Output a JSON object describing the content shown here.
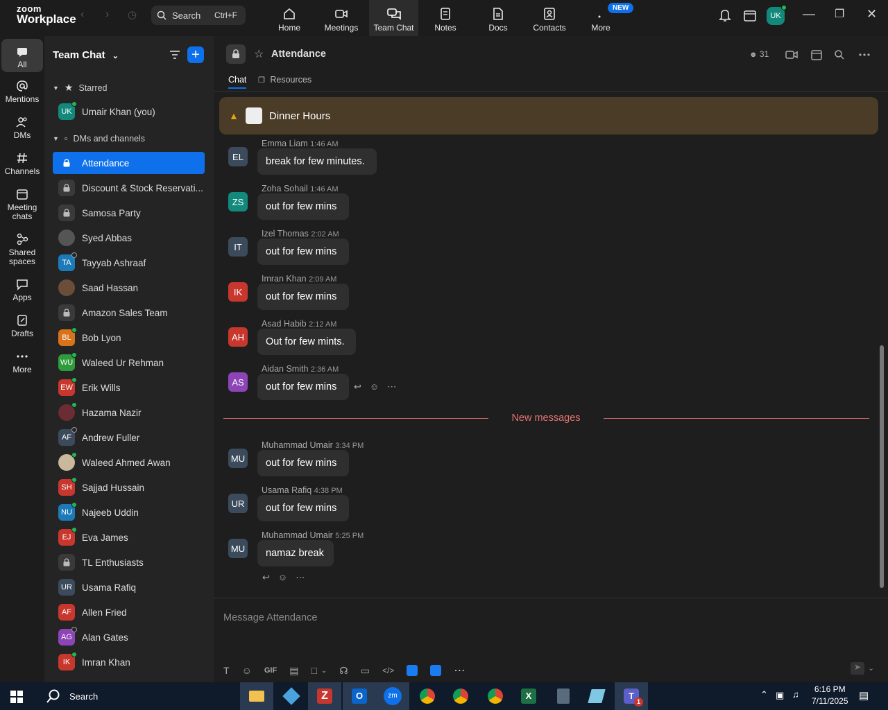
{
  "app": {
    "brand_top": "zoom",
    "brand_bottom": "Workplace"
  },
  "search": {
    "label": "Search",
    "shortcut": "Ctrl+F"
  },
  "tabs": [
    {
      "label": "Home"
    },
    {
      "label": "Meetings"
    },
    {
      "label": "Team Chat"
    },
    {
      "label": "Notes"
    },
    {
      "label": "Docs"
    },
    {
      "label": "Contacts"
    },
    {
      "label": "More",
      "badge": "NEW"
    }
  ],
  "user": {
    "initials": "UK"
  },
  "rail": [
    {
      "label": "All"
    },
    {
      "label": "Mentions"
    },
    {
      "label": "DMs"
    },
    {
      "label": "Channels"
    },
    {
      "label": "Meeting chats"
    },
    {
      "label": "Shared spaces"
    },
    {
      "label": "Apps"
    },
    {
      "label": "Drafts"
    },
    {
      "label": "More"
    }
  ],
  "sidebar": {
    "title": "Team Chat",
    "starred": "Starred",
    "dms": "DMs and channels",
    "starred_items": [
      {
        "label": "Umair Khan (you)",
        "initials": "UK",
        "color": "#13897b"
      }
    ],
    "items": [
      {
        "label": "Attendance",
        "type": "lock"
      },
      {
        "label": "Discount & Stock Reservati...",
        "type": "lock"
      },
      {
        "label": "Samosa Party",
        "type": "lock"
      },
      {
        "label": "Syed Abbas",
        "type": "photo",
        "color": "#555"
      },
      {
        "label": "Tayyab Ashraaf",
        "initials": "TA",
        "color": "#1d7ab8",
        "status": "off"
      },
      {
        "label": "Saad Hassan",
        "type": "photo",
        "color": "#6a4e3a"
      },
      {
        "label": "Amazon Sales Team",
        "type": "lock"
      },
      {
        "label": "Bob Lyon",
        "initials": "BL",
        "color": "#d9731a",
        "status": "on"
      },
      {
        "label": "Waleed Ur Rehman",
        "initials": "WU",
        "color": "#2e9c3c",
        "status": "on"
      },
      {
        "label": "Erik Wills",
        "initials": "EW",
        "color": "#c8372d",
        "status": "on"
      },
      {
        "label": "Hazama Nazir",
        "type": "photo",
        "color": "#6b2d33",
        "status": "on"
      },
      {
        "label": "Andrew Fuller",
        "initials": "AF",
        "color": "#3b4b5c",
        "status": "off"
      },
      {
        "label": "Waleed Ahmed Awan",
        "type": "photo",
        "color": "#c9b89c",
        "status": "on"
      },
      {
        "label": "Sajjad Hussain",
        "initials": "SH",
        "color": "#c8372d",
        "status": "on"
      },
      {
        "label": "Najeeb Uddin",
        "initials": "NU",
        "color": "#1d7ab8",
        "status": "on"
      },
      {
        "label": "Eva James",
        "initials": "EJ",
        "color": "#c8372d",
        "status": "on"
      },
      {
        "label": "TL Enthusiasts",
        "type": "lock"
      },
      {
        "label": "Usama Rafiq",
        "initials": "UR",
        "color": "#3b4b5c"
      },
      {
        "label": "Allen Fried",
        "initials": "AF",
        "color": "#c8372d"
      },
      {
        "label": "Alan Gates",
        "initials": "AG",
        "color": "#8c44b6",
        "status": "off"
      },
      {
        "label": "Imran Khan",
        "initials": "IK",
        "color": "#c8372d",
        "status": "on"
      }
    ]
  },
  "channel": {
    "name": "Attendance",
    "tabs": [
      "Chat",
      "Resources"
    ],
    "members": "31",
    "pinned": "Dinner Hours",
    "composer_placeholder": "Message Attendance",
    "new_messages": "New messages",
    "messages": [
      {
        "initials": "EL",
        "color": "#3b4b5c",
        "sender": "Emma Liam",
        "time": "1:46 AM",
        "text": "break for few minutes."
      },
      {
        "initials": "ZS",
        "color": "#13897b",
        "sender": "Zoha Sohail",
        "time": "1:46 AM",
        "text": "out for few mins"
      },
      {
        "initials": "IT",
        "color": "#3b4b5c",
        "sender": "Izel Thomas",
        "time": "2:02 AM",
        "text": "out for few mins"
      },
      {
        "initials": "IK",
        "color": "#c8372d",
        "sender": "Imran Khan",
        "time": "2:09 AM",
        "text": "out for few mins"
      },
      {
        "initials": "AH",
        "color": "#c8372d",
        "sender": "Asad Habib",
        "time": "2:12 AM",
        "text": "Out for few mints."
      },
      {
        "initials": "AS",
        "color": "#8c44b6",
        "sender": "Aidan Smith",
        "time": "2:36 AM",
        "text": "out for few mins"
      },
      {
        "initials": "MU",
        "color": "#3b4b5c",
        "sender": "Muhammad Umair",
        "time": "3:34 PM",
        "text": "out for few mins"
      },
      {
        "initials": "UR",
        "color": "#3b4b5c",
        "sender": "Usama Rafiq",
        "time": "4:38 PM",
        "text": "out for few mins"
      },
      {
        "initials": "MU",
        "color": "#3b4b5c",
        "sender": "Muhammad Umair",
        "time": "5:25 PM",
        "text": "namaz break"
      }
    ],
    "toolbar_gif": "GIF"
  },
  "taskbar": {
    "search": "Search",
    "time": "6:16 PM",
    "date": "7/11/2025",
    "teams_badge": "1"
  }
}
